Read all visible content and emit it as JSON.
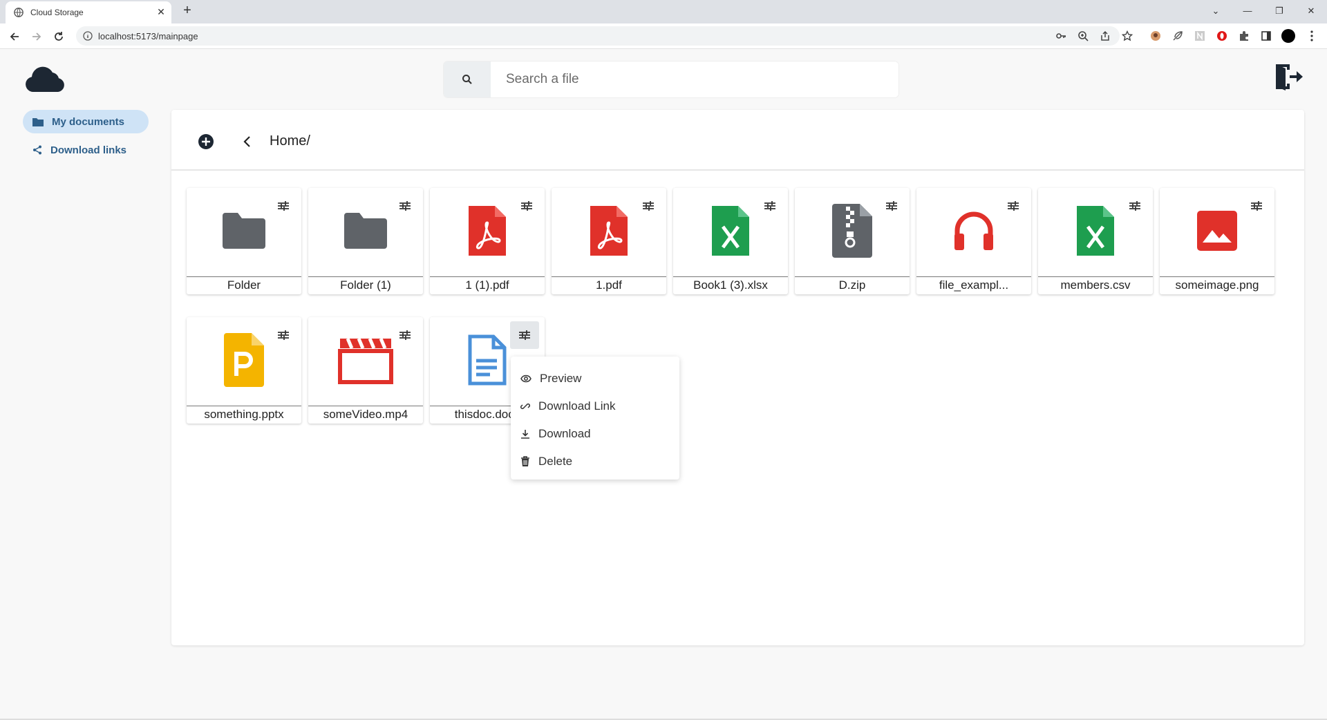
{
  "browser": {
    "tab_title": "Cloud Storage",
    "new_tab_symbol": "+",
    "url": "localhost:5173/mainpage"
  },
  "search": {
    "placeholder": "Search a file"
  },
  "sidebar": {
    "items": [
      {
        "label": "My documents",
        "icon": "folder-icon",
        "active": true
      },
      {
        "label": "Download links",
        "icon": "share-icon",
        "active": false
      }
    ]
  },
  "breadcrumb": {
    "path": "Home/"
  },
  "files": [
    {
      "name": "Folder",
      "icon": "folder-icon",
      "color": "#5f6368"
    },
    {
      "name": "Folder (1)",
      "icon": "folder-icon",
      "color": "#5f6368"
    },
    {
      "name": "1 (1).pdf",
      "icon": "pdf-icon",
      "color": "#e0312a"
    },
    {
      "name": "1.pdf",
      "icon": "pdf-icon",
      "color": "#e0312a"
    },
    {
      "name": "Book1 (3).xlsx",
      "icon": "excel-icon",
      "color": "#1e9e4f"
    },
    {
      "name": "D.zip",
      "icon": "zip-icon",
      "color": "#5f6368"
    },
    {
      "name": "file_exampl...",
      "icon": "headphones-icon",
      "color": "#e0312a"
    },
    {
      "name": "members.csv",
      "icon": "excel-icon",
      "color": "#1e9e4f"
    },
    {
      "name": "someimage.png",
      "icon": "image-icon",
      "color": "#e0312a"
    },
    {
      "name": "something.pptx",
      "icon": "powerpoint-icon",
      "color": "#f4b400"
    },
    {
      "name": "someVideo.mp4",
      "icon": "video-icon",
      "color": "#e0312a"
    },
    {
      "name": "thisdoc.docx",
      "icon": "document-icon",
      "color": "#4a90d9"
    }
  ],
  "context_menu": {
    "items": [
      {
        "label": "Preview",
        "icon": "eye-icon"
      },
      {
        "label": "Download Link",
        "icon": "link-icon"
      },
      {
        "label": "Download",
        "icon": "download-icon"
      },
      {
        "label": "Delete",
        "icon": "trash-icon"
      }
    ]
  }
}
